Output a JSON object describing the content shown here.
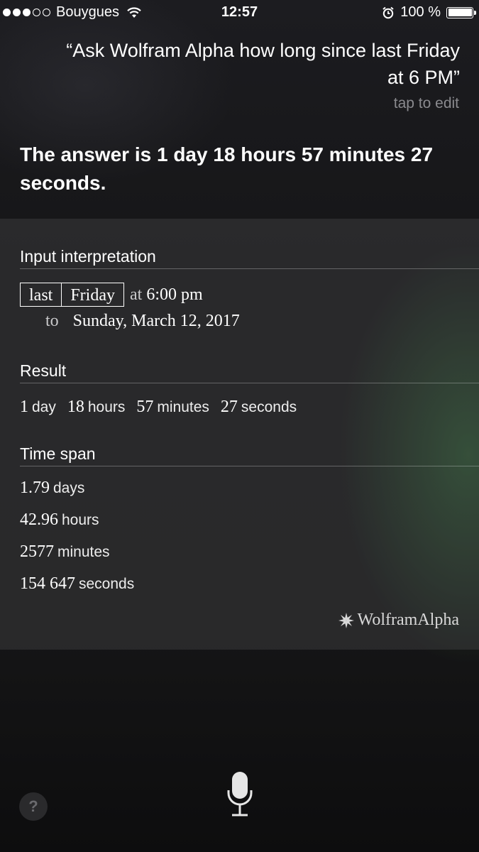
{
  "status_bar": {
    "signal_bars_filled": 3,
    "signal_bars_total": 5,
    "carrier": "Bouygues",
    "time": "12:57",
    "battery": "100 %"
  },
  "siri": {
    "query": "“Ask Wolfram Alpha how long since last Friday at 6 PM”",
    "tap_to_edit": "tap to edit",
    "answer": "The answer is 1 day 18 hours 57 minutes 27 seconds."
  },
  "card": {
    "input_interpretation": {
      "title": "Input interpretation",
      "box1": "last",
      "box2": "Friday",
      "at_word": "at",
      "at_time": "6:00 pm",
      "to_word": "to",
      "to_date": "Sunday, March 12, 2017"
    },
    "result": {
      "title": "Result",
      "parts": [
        {
          "num": "1",
          "unit": "day"
        },
        {
          "num": "18",
          "unit": "hours"
        },
        {
          "num": "57",
          "unit": "minutes"
        },
        {
          "num": "27",
          "unit": "seconds"
        }
      ]
    },
    "time_span": {
      "title": "Time span",
      "items": [
        {
          "num": "1.79",
          "unit": "days"
        },
        {
          "num": "42.96",
          "unit": "hours"
        },
        {
          "num": "2577",
          "unit": "minutes"
        },
        {
          "num": "154 647",
          "unit": "seconds"
        }
      ]
    },
    "logo_text": "WolframAlpha"
  },
  "bottom": {
    "help_label": "?",
    "mic_icon": "microphone-icon"
  }
}
